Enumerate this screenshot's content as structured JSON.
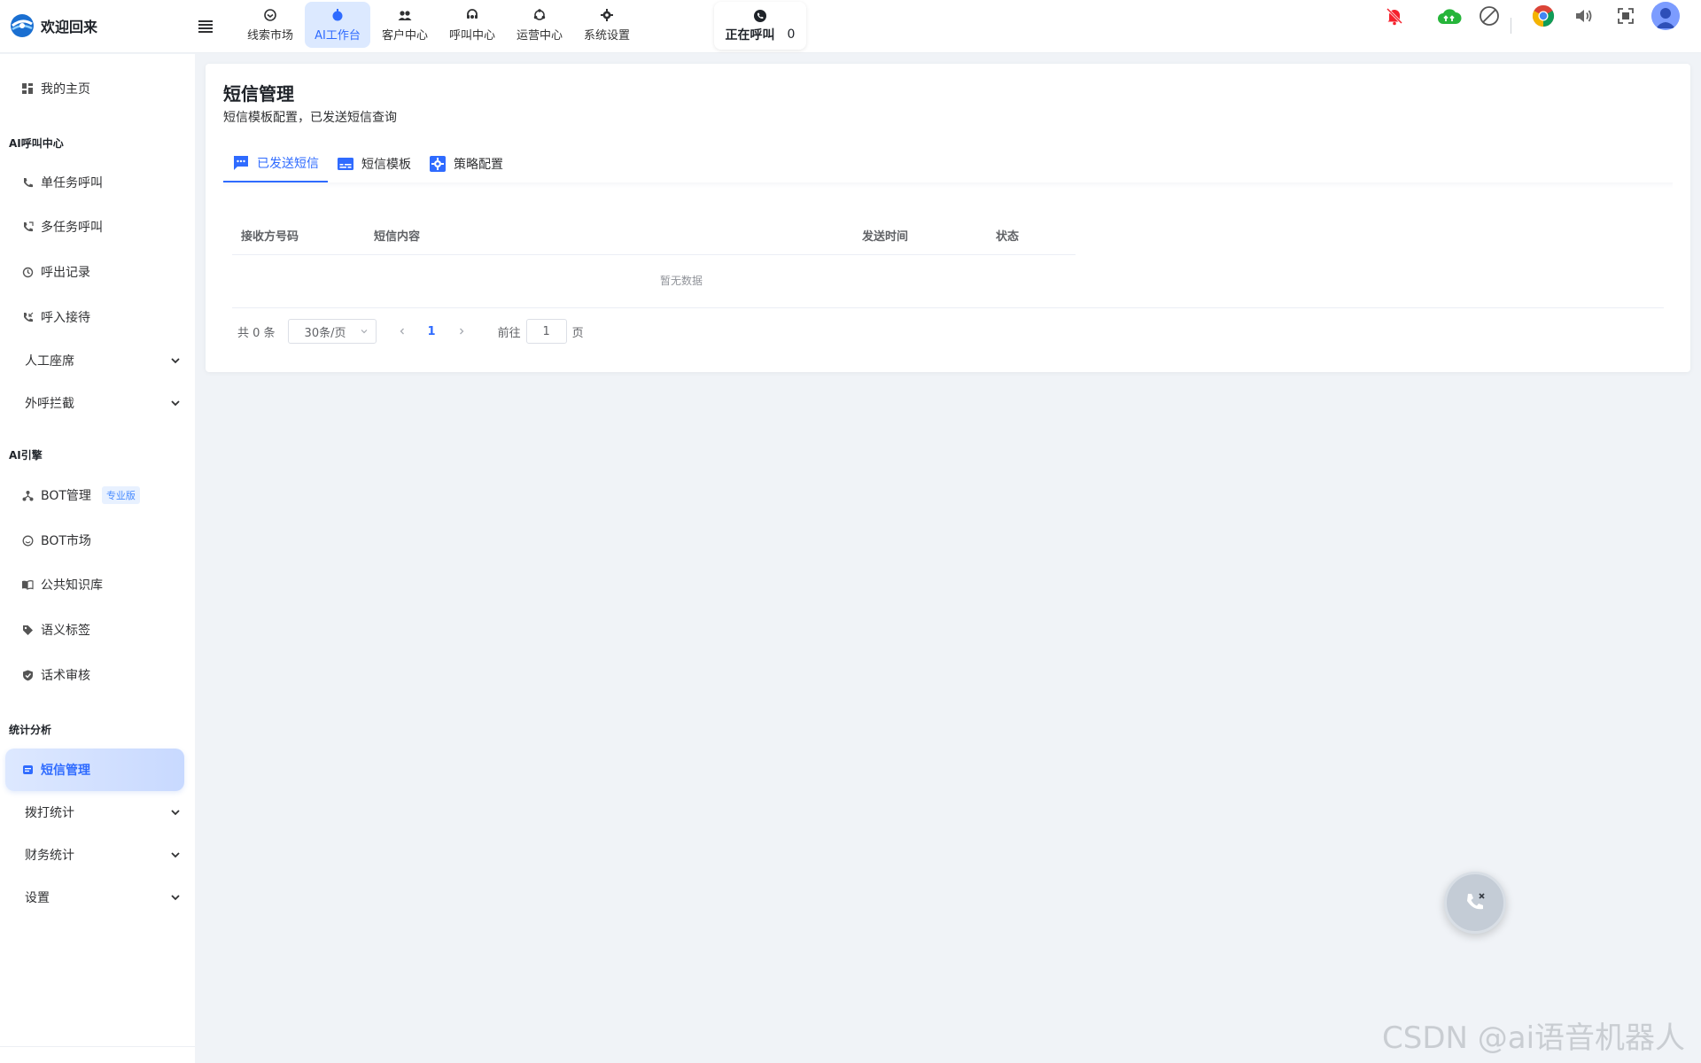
{
  "app": {
    "title": "欢迎回来"
  },
  "topnav": [
    {
      "label": "线索市场",
      "icon": "clue-icon"
    },
    {
      "label": "AI工作台",
      "icon": "ai-workbench-icon",
      "active": true
    },
    {
      "label": "客户中心",
      "icon": "customers-icon"
    },
    {
      "label": "呼叫中心",
      "icon": "headset-icon"
    },
    {
      "label": "运营中心",
      "icon": "operations-icon"
    },
    {
      "label": "系统设置",
      "icon": "gear-icon"
    }
  ],
  "call_status": {
    "label": "正在呼叫",
    "count": "0"
  },
  "sidebar": {
    "home": "我的主页",
    "groups": {
      "ai_call": "AI呼叫中心",
      "ai_engine": "AI引擎",
      "stats": "统计分析"
    },
    "items": {
      "single_task": "单任务呼叫",
      "multi_task": "多任务呼叫",
      "outbound_records": "呼出记录",
      "inbound": "呼入接待",
      "agents": "人工座席",
      "intercept": "外呼拦截",
      "bot_manage": "BOT管理",
      "pro_badge": "专业版",
      "bot_market": "BOT市场",
      "knowledge": "公共知识库",
      "semantic_tags": "语义标签",
      "script_review": "话术审核",
      "sms": "短信管理",
      "dial_stats": "拨打统计",
      "finance_stats": "财务统计",
      "settings": "设置"
    }
  },
  "page": {
    "title": "短信管理",
    "subtitle": "短信模板配置，已发送短信查询",
    "tabs": [
      {
        "label": "已发送短信",
        "active": true
      },
      {
        "label": "短信模板"
      },
      {
        "label": "策略配置"
      }
    ],
    "table": {
      "columns": [
        "接收方号码",
        "短信内容",
        "发送时间",
        "状态"
      ],
      "rows": [],
      "empty_text": "暂无数据"
    },
    "pagination": {
      "total": "共 0 条",
      "page_size": "30条/页",
      "current_page": "1",
      "goto_label": "前往",
      "goto_value": "1",
      "page_suffix": "页"
    }
  },
  "watermark": "CSDN @ai语音机器人",
  "colors": {
    "accent": "#2f6bff",
    "active_bg": "#dce9ff",
    "bg": "#f0f3f7"
  }
}
